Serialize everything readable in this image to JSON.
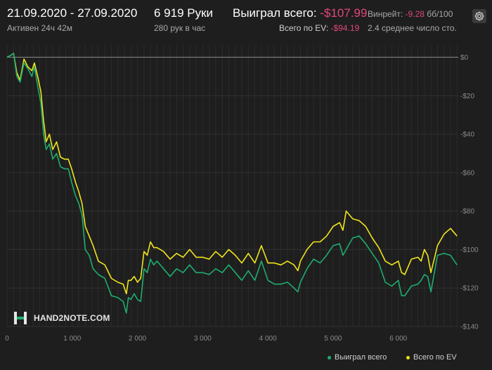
{
  "header": {
    "dates": "21.09.2020 - 27.09.2020",
    "active": "Активен 24ч 42м",
    "hands": "6 919 Руки",
    "per_hour": "280 рук в час",
    "won_label": "Выиграл всего:",
    "won_value": "-$107.99",
    "ev_label": "Всего по EV:",
    "ev_value": "-$94.19",
    "winrate_label": "Винрейт:",
    "winrate_value": "-9.28",
    "winrate_unit": "бб/100",
    "stdev": "2.4 среднее число сто."
  },
  "logo": {
    "text": "HAND2NOTE.COM"
  },
  "legend": {
    "won": "Выиграл всего",
    "ev": "Всего по EV"
  },
  "colors": {
    "won_series": "#1ead6f",
    "ev_series": "#f0e51c",
    "negative": "#e0467c",
    "background": "#1e1e1e"
  },
  "icons": {
    "settings": "gear-icon",
    "logo": "hand2note-logo-icon"
  },
  "chart_data": {
    "type": "line",
    "x_ticks": [
      "0",
      "1 000",
      "2 000",
      "3 000",
      "4 000",
      "5 000",
      "6 000"
    ],
    "y_ticks": [
      "$0",
      "-$20",
      "-$40",
      "-$60",
      "-$80",
      "-$100",
      "-$120",
      "-$140"
    ],
    "xlim": [
      0,
      6919
    ],
    "ylim": [
      -140,
      2
    ],
    "grid": true,
    "legend_position": "bottom-right",
    "series": [
      {
        "name": "Выиграл всего",
        "x": [
          0,
          60,
          100,
          150,
          200,
          260,
          320,
          380,
          420,
          470,
          520,
          560,
          600,
          650,
          700,
          760,
          820,
          880,
          940,
          990,
          1050,
          1100,
          1150,
          1200,
          1260,
          1320,
          1400,
          1500,
          1600,
          1700,
          1780,
          1830,
          1860,
          1900,
          1950,
          2000,
          2050,
          2100,
          2150,
          2200,
          2250,
          2300,
          2400,
          2500,
          2600,
          2700,
          2800,
          2900,
          3000,
          3100,
          3200,
          3300,
          3400,
          3500,
          3600,
          3700,
          3800,
          3900,
          4000,
          4100,
          4200,
          4300,
          4400,
          4460,
          4500,
          4600,
          4700,
          4800,
          4900,
          5000,
          5100,
          5150,
          5200,
          5300,
          5400,
          5500,
          5600,
          5700,
          5800,
          5900,
          6000,
          6050,
          6100,
          6200,
          6300,
          6350,
          6400,
          6450,
          6500,
          6600,
          6700,
          6800,
          6900
        ],
        "values": [
          0,
          1,
          2,
          -10,
          -13,
          -3,
          -6,
          -10,
          -5,
          -15,
          -24,
          -40,
          -48,
          -45,
          -53,
          -50,
          -57,
          -58,
          -58,
          -65,
          -72,
          -76,
          -82,
          -100,
          -103,
          -110,
          -113,
          -115,
          -124,
          -125,
          -127,
          -133,
          -125,
          -126,
          -123,
          -126,
          -127,
          -110,
          -112,
          -105,
          -108,
          -106,
          -110,
          -114,
          -110,
          -112,
          -108,
          -112,
          -112,
          -113,
          -110,
          -112,
          -108,
          -112,
          -116,
          -111,
          -116,
          -106,
          -116,
          -118,
          -118,
          -117,
          -120,
          -122,
          -117,
          -110,
          -105,
          -107,
          -103,
          -98,
          -97,
          -103,
          -100,
          -94,
          -93,
          -97,
          -102,
          -107,
          -117,
          -119,
          -116,
          -124,
          -124,
          -119,
          -118,
          -116,
          -113,
          -114,
          -122,
          -103,
          -102,
          -103,
          -108
        ]
      },
      {
        "name": "Всего по EV",
        "x": [
          0,
          60,
          100,
          150,
          200,
          260,
          320,
          380,
          420,
          470,
          520,
          560,
          600,
          650,
          700,
          760,
          820,
          880,
          940,
          990,
          1050,
          1100,
          1150,
          1200,
          1260,
          1320,
          1400,
          1500,
          1600,
          1700,
          1780,
          1830,
          1860,
          1900,
          1950,
          2000,
          2050,
          2100,
          2150,
          2200,
          2250,
          2300,
          2400,
          2500,
          2600,
          2700,
          2800,
          2900,
          3000,
          3100,
          3200,
          3300,
          3400,
          3500,
          3600,
          3700,
          3800,
          3900,
          4000,
          4100,
          4200,
          4300,
          4400,
          4460,
          4500,
          4600,
          4700,
          4800,
          4900,
          5000,
          5100,
          5150,
          5200,
          5300,
          5400,
          5500,
          5600,
          5700,
          5800,
          5900,
          6000,
          6050,
          6100,
          6200,
          6300,
          6350,
          6400,
          6450,
          6500,
          6600,
          6700,
          6800,
          6900
        ],
        "values": [
          0,
          1,
          2,
          -8,
          -12,
          -1,
          -5,
          -7,
          -3,
          -10,
          -18,
          -33,
          -44,
          -40,
          -48,
          -44,
          -52,
          -53,
          -53,
          -58,
          -65,
          -70,
          -76,
          -88,
          -93,
          -98,
          -106,
          -108,
          -115,
          -117,
          -118,
          -123,
          -116,
          -116,
          -114,
          -117,
          -115,
          -101,
          -103,
          -96,
          -99,
          -99,
          -101,
          -105,
          -102,
          -104,
          -100,
          -104,
          -104,
          -105,
          -101,
          -104,
          -100,
          -103,
          -107,
          -102,
          -107,
          -98,
          -107,
          -107,
          -108,
          -106,
          -108,
          -111,
          -106,
          -100,
          -96,
          -96,
          -93,
          -88,
          -86,
          -90,
          -80,
          -84,
          -85,
          -88,
          -94,
          -99,
          -106,
          -108,
          -106,
          -112,
          -113,
          -105,
          -104,
          -106,
          -100,
          -103,
          -112,
          -98,
          -92,
          -89,
          -93
        ]
      }
    ]
  }
}
